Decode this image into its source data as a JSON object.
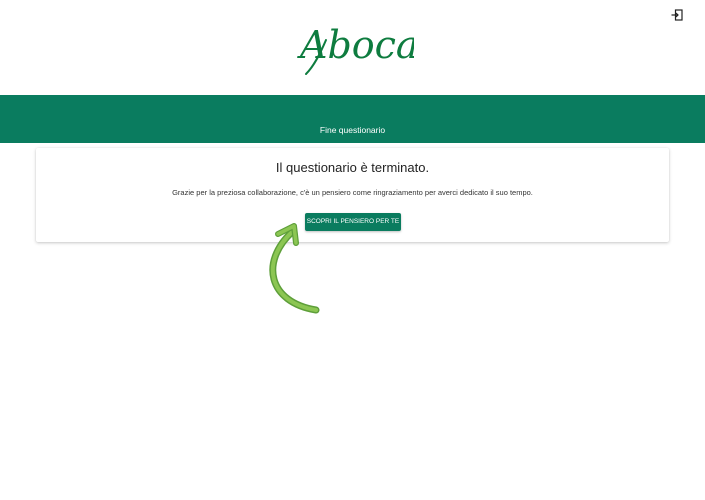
{
  "header": {
    "logo_text": "Aboca",
    "exit_icon": "exit-icon"
  },
  "banner": {
    "title": "Fine questionario"
  },
  "card": {
    "title": "Il questionario è terminato.",
    "message": "Grazie per la preziosa collaborazione, c'è un pensiero come ringraziamento per averci dedicato il suo tempo.",
    "button_label": "SCOPRI IL PENSIERO PER TE"
  },
  "colors": {
    "brand_green": "#0a7c5f",
    "logo_green": "#0e7c3f",
    "arrow_green": "#7ab648"
  },
  "annotation": {
    "arrow_icon": "curved-arrow-icon"
  }
}
